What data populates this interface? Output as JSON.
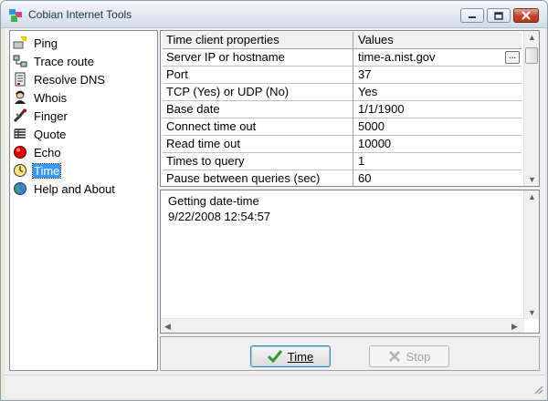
{
  "window": {
    "title": "Cobian Internet Tools",
    "icon": "app-icon",
    "controls": [
      "minimize",
      "maximize",
      "close"
    ]
  },
  "nav": {
    "items": [
      {
        "label": "Ping",
        "icon": "ping-icon",
        "selected": false
      },
      {
        "label": "Trace route",
        "icon": "trace-route-icon",
        "selected": false
      },
      {
        "label": "Resolve DNS",
        "icon": "resolve-dns-icon",
        "selected": false
      },
      {
        "label": "Whois",
        "icon": "whois-icon",
        "selected": false
      },
      {
        "label": "Finger",
        "icon": "finger-icon",
        "selected": false
      },
      {
        "label": "Quote",
        "icon": "quote-icon",
        "selected": false
      },
      {
        "label": "Echo",
        "icon": "echo-icon",
        "selected": false
      },
      {
        "label": "Time",
        "icon": "clock-icon",
        "selected": true
      },
      {
        "label": "Help and About",
        "icon": "globe-icon",
        "selected": false
      }
    ]
  },
  "grid": {
    "columns": [
      "Time client properties",
      "Values"
    ],
    "rows": [
      {
        "property": "Server IP or hostname",
        "value": "time-a.nist.gov",
        "has_button": true
      },
      {
        "property": "Port",
        "value": "37"
      },
      {
        "property": "TCP (Yes) or UDP (No)",
        "value": "Yes"
      },
      {
        "property": "Base date",
        "value": "1/1/1900"
      },
      {
        "property": "Connect time out",
        "value": "5000"
      },
      {
        "property": "Read time out",
        "value": "10000"
      },
      {
        "property": "Times to query",
        "value": "1"
      },
      {
        "property": "Pause between queries (sec)",
        "value": "60"
      }
    ],
    "ellipsis": "..."
  },
  "log": {
    "lines": [
      "Getting date-time",
      "9/22/2008 12:54:57"
    ]
  },
  "buttons": {
    "time_label": "Time",
    "stop_label": "Stop"
  },
  "colors": {
    "selection": "#3399ff",
    "close_button": "#c4432b",
    "check_green": "#2e9a2e"
  }
}
